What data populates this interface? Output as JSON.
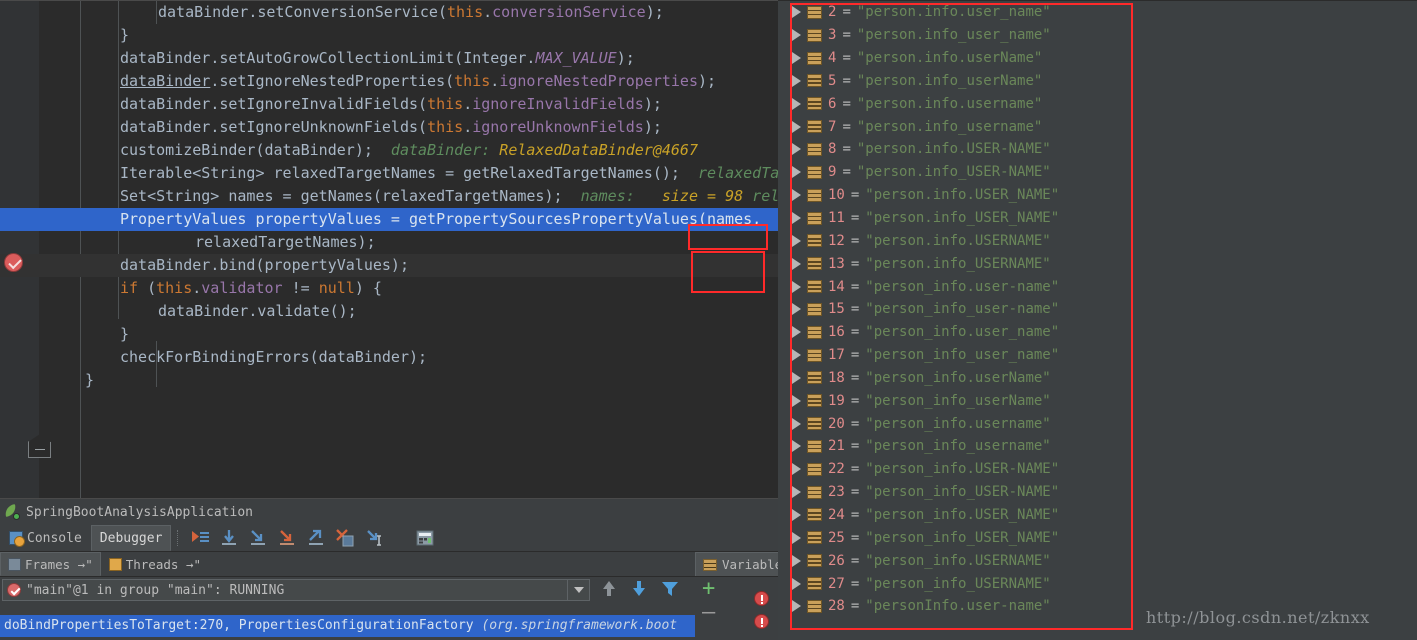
{
  "window": {
    "app_title": "SpringBootAnalysisApplication"
  },
  "editor": {
    "lines": [
      {
        "indent": 2,
        "tokens": [
          {
            "t": "dataBinder",
            "c": "s"
          },
          {
            "t": ".",
            "c": "p"
          },
          {
            "t": "setConversionService",
            "c": "m"
          },
          {
            "t": "(",
            "c": "p"
          },
          {
            "t": "this",
            "c": "k"
          },
          {
            "t": ".",
            "c": "p"
          },
          {
            "t": "conversionService",
            "c": "f"
          },
          {
            "t": ");",
            "c": "p"
          }
        ]
      },
      {
        "indent": 1,
        "tokens": [
          {
            "t": "}",
            "c": "p"
          }
        ]
      },
      {
        "indent": 1,
        "tokens": [
          {
            "t": "dataBinder",
            "c": "s"
          },
          {
            "t": ".",
            "c": "p"
          },
          {
            "t": "setAutoGrowCollectionLimit",
            "c": "m"
          },
          {
            "t": "(",
            "c": "p"
          },
          {
            "t": "Integer",
            "c": "s"
          },
          {
            "t": ".",
            "c": "p"
          },
          {
            "t": "MAX_VALUE",
            "c": "st"
          },
          {
            "t": ");",
            "c": "p"
          }
        ]
      },
      {
        "indent": 1,
        "tokens": [
          {
            "t": "dataBinder",
            "c": "un"
          },
          {
            "t": ".",
            "c": "p"
          },
          {
            "t": "setIgnoreNestedProperties",
            "c": "m"
          },
          {
            "t": "(",
            "c": "p"
          },
          {
            "t": "this",
            "c": "k"
          },
          {
            "t": ".",
            "c": "p"
          },
          {
            "t": "ignoreNestedProperties",
            "c": "f"
          },
          {
            "t": ");",
            "c": "p"
          }
        ]
      },
      {
        "indent": 1,
        "tokens": [
          {
            "t": "dataBinder",
            "c": "s"
          },
          {
            "t": ".",
            "c": "p"
          },
          {
            "t": "setIgnoreInvalidFields",
            "c": "m"
          },
          {
            "t": "(",
            "c": "p"
          },
          {
            "t": "this",
            "c": "k"
          },
          {
            "t": ".",
            "c": "p"
          },
          {
            "t": "ignoreInvalidFields",
            "c": "f"
          },
          {
            "t": ");",
            "c": "p"
          }
        ]
      },
      {
        "indent": 1,
        "tokens": [
          {
            "t": "dataBinder",
            "c": "s"
          },
          {
            "t": ".",
            "c": "p"
          },
          {
            "t": "setIgnoreUnknownFields",
            "c": "m"
          },
          {
            "t": "(",
            "c": "p"
          },
          {
            "t": "this",
            "c": "k"
          },
          {
            "t": ".",
            "c": "p"
          },
          {
            "t": "ignoreUnknownFields",
            "c": "f"
          },
          {
            "t": ");",
            "c": "p"
          }
        ]
      },
      {
        "indent": 1,
        "tokens": [
          {
            "t": "customizeBinder",
            "c": "m"
          },
          {
            "t": "(",
            "c": "p"
          },
          {
            "t": "dataBinder",
            "c": "s"
          },
          {
            "t": ");",
            "c": "p"
          },
          {
            "t": "  dataBinder:",
            "c": "hint"
          },
          {
            "t": " RelaxedDataBinder@4667",
            "c": "hintv"
          }
        ]
      },
      {
        "indent": 1,
        "tokens": [
          {
            "t": "Iterable<String> relaxedTargetNames = ",
            "c": "s"
          },
          {
            "t": "getRelaxedTargetNames",
            "c": "m"
          },
          {
            "t": "();",
            "c": "p"
          },
          {
            "t": "  relaxedTa",
            "c": "hint"
          }
        ]
      },
      {
        "indent": 1,
        "tokens": [
          {
            "t": "Set<String> names = ",
            "c": "s"
          },
          {
            "t": "getNames",
            "c": "m"
          },
          {
            "t": "(relaxedTargetNames);",
            "c": "p"
          },
          {
            "t": "  names:",
            "c": "hint"
          },
          {
            "t": "   size = 98",
            "c": "hintv"
          },
          {
            "t": " rel",
            "c": "hint"
          }
        ]
      },
      {
        "indent": 1,
        "highlight": true,
        "tokens": [
          {
            "t": "PropertyValues propertyValues = ",
            "c": "hlt"
          },
          {
            "t": "getPropertySourcesPropertyValues",
            "c": "hlt"
          },
          {
            "t": "(names,",
            "c": "hlt"
          }
        ]
      },
      {
        "indent": 3,
        "tokens": [
          {
            "t": "relaxedTargetNames);",
            "c": "p"
          }
        ]
      },
      {
        "indent": 1,
        "context": true,
        "tokens": [
          {
            "t": "dataBinder",
            "c": "s"
          },
          {
            "t": ".",
            "c": "p"
          },
          {
            "t": "bind",
            "c": "m"
          },
          {
            "t": "(propertyValues);",
            "c": "p"
          }
        ]
      },
      {
        "indent": 1,
        "tokens": [
          {
            "t": "if",
            "c": "k"
          },
          {
            "t": " (",
            "c": "p"
          },
          {
            "t": "this",
            "c": "k"
          },
          {
            "t": ".",
            "c": "p"
          },
          {
            "t": "validator",
            "c": "f"
          },
          {
            "t": " != ",
            "c": "p"
          },
          {
            "t": "null",
            "c": "k"
          },
          {
            "t": ") {",
            "c": "p"
          }
        ]
      },
      {
        "indent": 2,
        "tokens": [
          {
            "t": "dataBinder",
            "c": "s"
          },
          {
            "t": ".",
            "c": "p"
          },
          {
            "t": "validate",
            "c": "m"
          },
          {
            "t": "();",
            "c": "p"
          }
        ]
      },
      {
        "indent": 1,
        "tokens": [
          {
            "t": "}",
            "c": "p"
          }
        ]
      },
      {
        "indent": 1,
        "tokens": [
          {
            "t": "checkForBindingErrors",
            "c": "m"
          },
          {
            "t": "(dataBinder);",
            "c": "p"
          }
        ]
      },
      {
        "indent": 0,
        "tokens": [
          {
            "t": "}",
            "c": "p"
          }
        ]
      }
    ],
    "annotations": [
      {
        "name": "size-annotation-box",
        "label": "size = 98"
      },
      {
        "name": "names-annotation-box",
        "label": "(names,"
      }
    ]
  },
  "debugger": {
    "tabs": [
      {
        "label": "Console",
        "active": false,
        "icon": "console-icon"
      },
      {
        "label": "Debugger",
        "active": true,
        "icon": "none"
      }
    ],
    "toolbar_icons": [
      "show-execution-point-icon",
      "step-over-icon",
      "step-into-icon",
      "force-step-into-icon",
      "step-out-icon",
      "drop-frame-icon",
      "run-to-cursor-icon",
      "evaluate-expression-icon"
    ],
    "view_tabs": [
      {
        "label": "Frames →\"",
        "active": true,
        "icon": "frames-icon"
      },
      {
        "label": "Threads →\"",
        "active": false,
        "icon": "threads-icon"
      }
    ],
    "variables_tab_label": "Variable",
    "thread_selector": "\"main\"@1 in group \"main\": RUNNING",
    "thread_tools": [
      "up-arrow-icon",
      "down-arrow-icon",
      "filter-icon"
    ],
    "add_label": "+",
    "remove_label": "—",
    "frame_row": {
      "method": "doBindPropertiesToTarget:270, PropertiesConfigurationFactory ",
      "package": "(org.springframework.boot"
    }
  },
  "variables": {
    "rows": [
      {
        "index": "2",
        "value": "\"person.info.user_name\""
      },
      {
        "index": "3",
        "value": "\"person.info_user_name\""
      },
      {
        "index": "4",
        "value": "\"person.info.userName\""
      },
      {
        "index": "5",
        "value": "\"person.info_userName\""
      },
      {
        "index": "6",
        "value": "\"person.info.username\""
      },
      {
        "index": "7",
        "value": "\"person.info_username\""
      },
      {
        "index": "8",
        "value": "\"person.info.USER-NAME\""
      },
      {
        "index": "9",
        "value": "\"person.info_USER-NAME\""
      },
      {
        "index": "10",
        "value": "\"person.info.USER_NAME\""
      },
      {
        "index": "11",
        "value": "\"person.info_USER_NAME\""
      },
      {
        "index": "12",
        "value": "\"person.info.USERNAME\""
      },
      {
        "index": "13",
        "value": "\"person.info_USERNAME\""
      },
      {
        "index": "14",
        "value": "\"person_info.user-name\""
      },
      {
        "index": "15",
        "value": "\"person_info_user-name\""
      },
      {
        "index": "16",
        "value": "\"person_info.user_name\""
      },
      {
        "index": "17",
        "value": "\"person_info_user_name\""
      },
      {
        "index": "18",
        "value": "\"person_info.userName\""
      },
      {
        "index": "19",
        "value": "\"person_info_userName\""
      },
      {
        "index": "20",
        "value": "\"person_info.username\""
      },
      {
        "index": "21",
        "value": "\"person_info_username\""
      },
      {
        "index": "22",
        "value": "\"person_info.USER-NAME\""
      },
      {
        "index": "23",
        "value": "\"person_info_USER-NAME\""
      },
      {
        "index": "24",
        "value": "\"person_info.USER_NAME\""
      },
      {
        "index": "25",
        "value": "\"person_info_USER_NAME\""
      },
      {
        "index": "26",
        "value": "\"person_info.USERNAME\""
      },
      {
        "index": "27",
        "value": "\"person_info_USERNAME\""
      },
      {
        "index": "28",
        "value": "\"personInfo.user-name\""
      }
    ]
  },
  "watermark": {
    "text": "http://blog.csdn.net/zknxx"
  },
  "colors": {
    "editor_bg": "#2b2b2b",
    "panel_bg": "#3c3f41",
    "selection_blue": "#2f65ca",
    "annotation_red": "#ff2a2a",
    "string_green": "#6a8759",
    "keyword_orange": "#cc7832",
    "field_purple": "#9876aa",
    "index_pink": "#e08b8b"
  }
}
